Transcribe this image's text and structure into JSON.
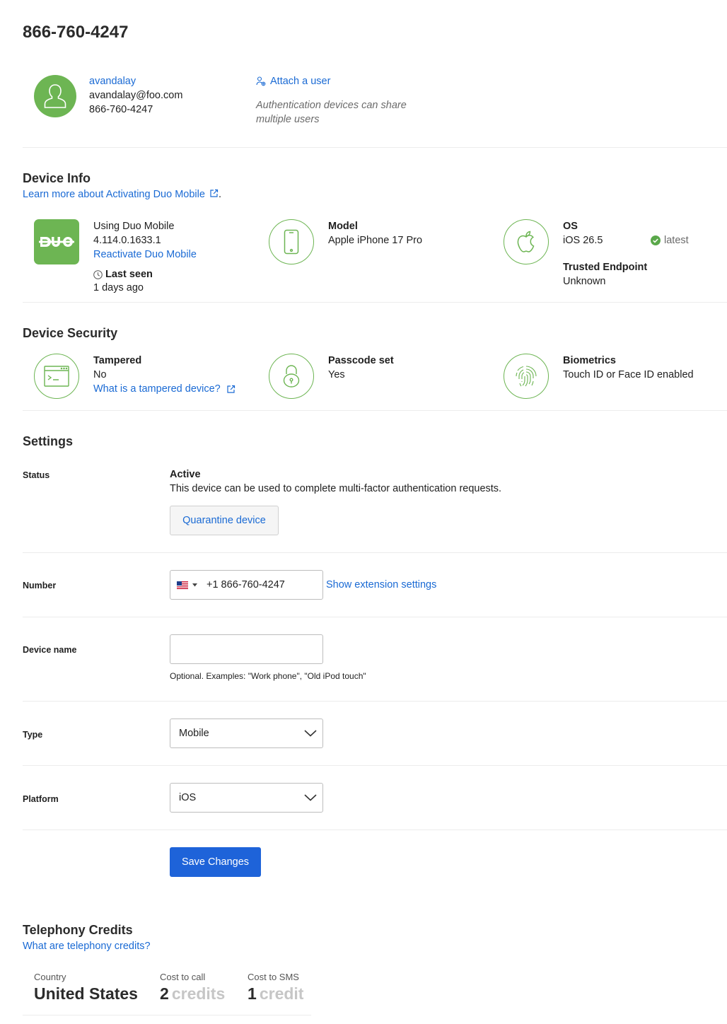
{
  "page": {
    "title": "866-760-4247"
  },
  "user": {
    "username": "avandalay",
    "email": "avandalay@foo.com",
    "phone": "866-760-4247",
    "attach_label": "Attach a user",
    "attach_note": "Authentication devices can share multiple users"
  },
  "device_info": {
    "title": "Device Info",
    "learn_more": "Learn more about Activating Duo Mobile",
    "app": {
      "using": "Using Duo Mobile",
      "version": "4.114.0.1633.1",
      "reactivate": "Reactivate Duo Mobile",
      "last_seen_label": "Last seen",
      "last_seen_value": "1 days ago"
    },
    "model": {
      "label": "Model",
      "value": "Apple iPhone 17 Pro"
    },
    "os": {
      "label": "OS",
      "value": "iOS 26.5",
      "status": "latest",
      "trusted_label": "Trusted Endpoint",
      "trusted_value": "Unknown"
    }
  },
  "device_security": {
    "title": "Device Security",
    "tampered": {
      "label": "Tampered",
      "value": "No",
      "link": "What is a tampered device?"
    },
    "passcode": {
      "label": "Passcode set",
      "value": "Yes"
    },
    "biometrics": {
      "label": "Biometrics",
      "value": "Touch ID or Face ID enabled"
    }
  },
  "settings": {
    "title": "Settings",
    "status": {
      "label": "Status",
      "value": "Active",
      "description": "This device can be used to complete multi-factor authentication requests.",
      "quarantine_button": "Quarantine device"
    },
    "number": {
      "label": "Number",
      "value": "+1 866-760-4247",
      "extension_link": "Show extension settings"
    },
    "device_name": {
      "label": "Device name",
      "value": "",
      "help": "Optional. Examples: \"Work phone\", \"Old iPod touch\""
    },
    "type": {
      "label": "Type",
      "value": "Mobile"
    },
    "platform": {
      "label": "Platform",
      "value": "iOS"
    },
    "save_button": "Save Changes"
  },
  "telephony": {
    "title": "Telephony Credits",
    "link": "What are telephony credits?",
    "country_label": "Country",
    "country_value": "United States",
    "call_label": "Cost to call",
    "call_value": "2",
    "call_unit": "credits",
    "sms_label": "Cost to SMS",
    "sms_value": "1",
    "sms_unit": "credit"
  },
  "colors": {
    "accent": "#6db553",
    "link": "#1a6ad4",
    "primary_button": "#1e63d9"
  }
}
